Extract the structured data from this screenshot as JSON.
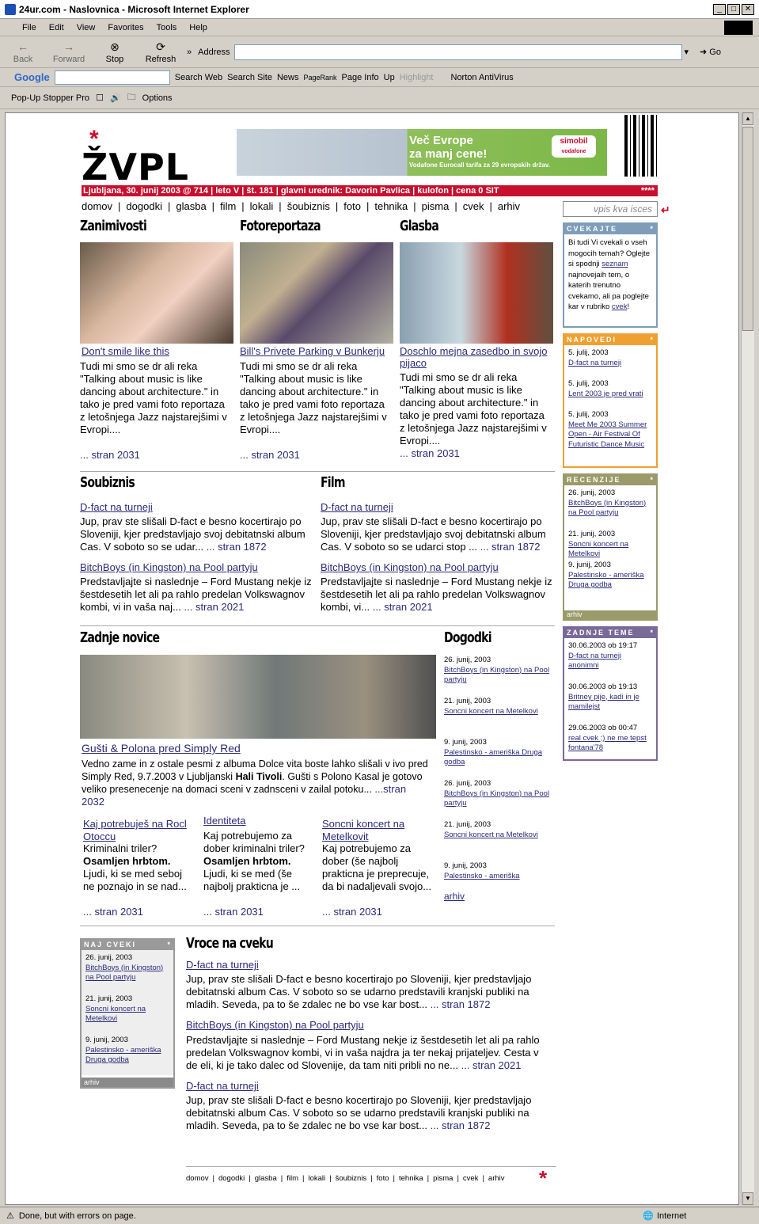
{
  "window": {
    "title": "24ur.com - Naslovnica - Microsoft Internet Explorer",
    "min": "_",
    "max": "□",
    "close": "✕"
  },
  "menu": [
    "File",
    "Edit",
    "View",
    "Favorites",
    "Tools",
    "Help"
  ],
  "toolbar": {
    "back": "Back",
    "forward": "Forward",
    "stop": "Stop",
    "refresh": "Refresh",
    "address_label": "Address",
    "go": "Go",
    "chevron": "»"
  },
  "google_bar": {
    "google": "Google",
    "search_web": "Search Web",
    "search_site": "Search Site",
    "news": "News",
    "pagerank": "PageRank",
    "page_info": "Page Info",
    "up": "Up",
    "highlight": "Highlight",
    "norton": "Norton AntiVirus"
  },
  "popup_bar": {
    "label": "Pop-Up Stopper Pro",
    "options": "Options"
  },
  "status": {
    "text": "Done, but with errors on page.",
    "zone": "Internet"
  },
  "site": {
    "logo": "ŽVPL",
    "logo_star": "*",
    "banner": {
      "line1": "Več Evrope",
      "line2": "za manj cene!",
      "line3": "Vodafone Eurocall tarifa za 29 evropskih držav.",
      "brand": "simobil",
      "brand2": "vodafone"
    },
    "infobar": "Ljubljana, 30. junij 2003 @ 714  |  leto V  |  št. 181  |  glavni urednik: Davorin Pavlica  |  kulofon  |  cena 0 SIT",
    "infobar_stars": "****",
    "nav": [
      "domov",
      "dogodki",
      "glasba",
      "film",
      "lokali",
      "šoubiznis",
      "foto",
      "tehnika",
      "pisma",
      "cvek",
      "arhiv"
    ],
    "search_placeholder": "vpis kva isces",
    "col1": {
      "heading": "Zanimivosti",
      "link": "Don't smile like this",
      "text": "Tudi mi smo se dr ali reka \"Talking about music is like dancing about architecture.\" in tako je pred vami foto reportaza z letošnjega Jazz najstarejšimi v Evropi....",
      "more": "... stran 2031"
    },
    "col2": {
      "heading": "Fotoreportaza",
      "link": "Bill's Privete Parking v Bunkerju",
      "text": "Tudi mi smo se dr ali reka \"Talking about music is like dancing about architecture.\" in tako je pred vami foto reportaza z letošnjega Jazz najstarejšimi v Evropi....",
      "more": "... stran 2031"
    },
    "col3": {
      "heading": "Glasba",
      "link": "Doschlo mejna zasedbo in svojo pijaco",
      "text": "Tudi mi smo se dr ali reka \"Talking about music is like dancing about architecture.\" in tako je pred vami foto reportaza z letošnjega Jazz najstarejšimi v Evropi....",
      "more": "... stran 2031"
    },
    "soubiznis": {
      "heading": "Soubiznis",
      "a1_link": "D-fact na turneji",
      "a1_text": "Jup, prav ste slišali D-fact  e besno kocertirajo po Sloveniji, kjer predstavljajo svoj debitatnski album Cas. V soboto so se udar... ",
      "a1_more": "... stran 1872",
      "a2_link": "BitchBoys (in Kingston) na Pool partyju",
      "a2_text": "Predstavljajte si naslednje – Ford Mustang nekje iz šestdesetih let ali pa rahlo predelan Volkswagnov kombi, vi in vaša naj... ",
      "a2_more": "... stran 2021"
    },
    "film": {
      "heading": "Film",
      "a1_link": "D-fact na turneji",
      "a1_text": "Jup, prav ste slišali D-fact  e besno kocertirajo po Sloveniji, kjer predstavljajo svoj debitatnski album Cas. V soboto so se udarci stop ... ",
      "a1_more": "... stran 1872",
      "a2_link": "BitchBoys (in Kingston) na Pool partyju",
      "a2_text": "Predstavljajte si naslednje – Ford Mustang nekje iz šestdesetih let ali pa rahlo predelan Volkswagnov kombi, vi... ",
      "a2_more": "... stran 2021"
    },
    "zadnje": {
      "heading": "Zadnje novice",
      "main_link": "Gušti & Polona pred Simply Red",
      "main_text_1": "Vedno zame in z ostale pesmi z albuma Dolce vita boste lahko slišali v  ivo pred Simply Red, 9.7.2003 v Ljubljanski ",
      "main_bold": "Hali Tivoli",
      "main_text_2": ". Gušti s Polono Kasal je gotovo veliko presenecenje na domaci sceni v zadnsceni v zailal potoku... ",
      "main_more": "...stran 2032",
      "s1_link": "Kaj potrebuješ na Rocl Otoccu",
      "s1_t1": "Kriminalni triler? ",
      "s1_bold": "Osamljen hrbtom.",
      "s1_t2": " Ljudi, ki se med seboj ne poznajo in se nad...",
      "s1_more": "... stran 2031",
      "s2_link": "Identiteta",
      "s2_t1": "Kaj potrebujemo za dober kriminalni triler? ",
      "s2_bold": "Osamljen hrbtom.",
      "s2_t2": " Ljudi, ki se med (še najbolj prakticna je ...",
      "s2_more": "... stran 2031",
      "s3_link": "Soncni koncert na Metelkovit",
      "s3_text": "Kaj potrebujemo za dober (še najbolj prakticna je preprecuje, da bi nadaljevali svojo...",
      "s3_more": "... stran 2031"
    },
    "dogodki": {
      "heading": "Dogodki",
      "items": [
        {
          "date": "26. junij, 2003",
          "link": "BitchBoys (in Kingston) na Pool partyju"
        },
        {
          "date": "21. junij, 2003",
          "link": "Soncni koncert na Metelkovi"
        },
        {
          "date": "9. junij, 2003",
          "link": "Palestinsko - ameriška Druga godba"
        },
        {
          "date": "26. junij, 2003",
          "link": "BitchBoys (in Kingston) na Pool partyju"
        },
        {
          "date": "21. junij, 2003",
          "link": "Soncni koncert na Metelkovi"
        },
        {
          "date": "9. junij, 2003",
          "link": "Palestinsko - ameriška"
        }
      ],
      "arhiv": "arhiv"
    },
    "cvekajte": {
      "title": "CVEKAJTE",
      "star": "*",
      "t1": "Bi tudi Vi cvekali o vseh mogocih temah? Oglejte si spodnji ",
      "link1": "seznam",
      "t2": " najnovejaih tem, o katerih trenutno cvekamo, ali pa poglejte kar v rubriko ",
      "link2": "cvek",
      "t3": "!"
    },
    "napovedi": {
      "title": "NAPOVEDI",
      "star": "*",
      "items": [
        {
          "date": "5. julij, 2003",
          "link": "D-fact na turneji"
        },
        {
          "date": "5. julij, 2003",
          "link": "Lent 2003 je pred vrati"
        },
        {
          "date": "5. julij, 2003",
          "link": "Meet Me 2003 Summer Open - Air Festival Of Futuristic Dance Music"
        }
      ]
    },
    "recenzije": {
      "title": "RECENZIJE",
      "star": "*",
      "items": [
        {
          "date": "26. junij, 2003",
          "link": "BitchBoys (in Kingston) na Pool partyju"
        },
        {
          "date": "21. junij, 2003",
          "link": "Soncni koncert na Metelkovi"
        },
        {
          "date": "9. junij, 2003",
          "link": "Palestinsko - ameriška Druga godba"
        }
      ],
      "arhiv": "arhiv"
    },
    "zadnje_teme": {
      "title": "ZADNJE TEME",
      "star": "*",
      "items": [
        {
          "date": "30.06.2003 ob 19:17",
          "link": "D-fact na turneji",
          "author": "anonimni"
        },
        {
          "date": "30.06.2003 ob 19:13",
          "link": "Britney pije, kadi in je mamilejst",
          "author": ""
        },
        {
          "date": "29.06.2003 ob 00:47",
          "link": "real cvek ;) ne me tepst fontana'78",
          "author": ""
        }
      ]
    },
    "naj_cveki": {
      "title": "NAJ CVEKI",
      "star": "*",
      "items": [
        {
          "date": "26. junij, 2003",
          "link": "BitchBoys (in Kingston) na Pool partyju"
        },
        {
          "date": "21. junij, 2003",
          "link": "Soncni koncert na Metelkovi"
        },
        {
          "date": "9. junij, 2003",
          "link": "Palestinsko - ameriška Druga godba"
        }
      ],
      "arhiv": "arhiv"
    },
    "vroce": {
      "heading": "Vroce na cveku",
      "a1_link": "D-fact na turneji",
      "a1_text": "Jup, prav ste slišali D-fact  e besno kocertirajo po Sloveniji, kjer predstavljajo debitatnski album Cas. V soboto so se udarno predstavili kranjski publiki na mladih. Seveda, pa to še zdalec ne bo vse kar bost... ",
      "a1_more": "... stran 1872",
      "a2_link": "BitchBoys (in Kingston) na Pool partyju",
      "a2_text": "Predstavljajte si naslednje – Ford Mustang nekje iz šestdesetih let ali pa rahlo predelan Volkswagnov kombi, vi in vaša najdra ja ter nekaj prijateljev. Cesta v de eli, ki je tako dalec od Slovenije, da tam niti pribli no ne... ",
      "a2_more": "... stran 2021",
      "a3_link": "D-fact na turneji",
      "a3_text": "Jup, prav ste slišali D-fact  e besno kocertirajo po Sloveniji, kjer predstavljajo debitatnski album Cas. V soboto so se udarno predstavili kranjski publiki na mladih. Seveda, pa to še zdalec ne bo vse kar bost... ",
      "a3_more": "... stran 1872"
    },
    "footer_nav": [
      "domov",
      "dogodki",
      "glasba",
      "film",
      "lokali",
      "šoubiznis",
      "foto",
      "tehnika",
      "pisma",
      "cvek",
      "arhiv"
    ],
    "footer_star": "*"
  }
}
